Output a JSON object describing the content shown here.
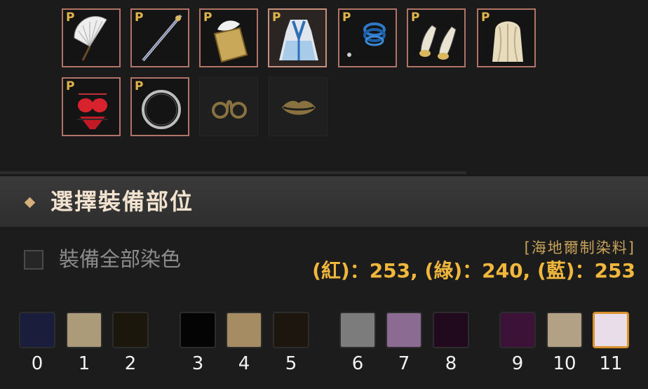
{
  "equipment": {
    "slots": [
      {
        "name": "fan",
        "premium": true,
        "badge": "P",
        "empty": false
      },
      {
        "name": "staff",
        "premium": true,
        "badge": "P",
        "empty": false
      },
      {
        "name": "book",
        "premium": true,
        "badge": "P",
        "empty": false
      },
      {
        "name": "outfit",
        "premium": true,
        "badge": "P",
        "empty": false,
        "selected": true
      },
      {
        "name": "bracelet",
        "premium": true,
        "badge": "P",
        "empty": false
      },
      {
        "name": "shoes",
        "premium": true,
        "badge": "P",
        "empty": false
      },
      {
        "name": "wig",
        "premium": true,
        "badge": "P",
        "empty": false
      },
      {
        "name": "underwear",
        "premium": true,
        "badge": "P",
        "empty": false
      },
      {
        "name": "ring",
        "premium": true,
        "badge": "P",
        "empty": false
      },
      {
        "name": "glasses",
        "premium": false,
        "empty": true
      },
      {
        "name": "lips",
        "premium": false,
        "empty": true
      }
    ]
  },
  "section": {
    "title": "選擇裝備部位"
  },
  "dye_all": {
    "label": "裝備全部染色",
    "checked": false
  },
  "dye": {
    "name": "[海地爾制染料]",
    "rgb_text": "(紅)：253, (綠)：240, (藍)：253"
  },
  "palette": [
    {
      "index": "0",
      "color": "#1b1d3c"
    },
    {
      "index": "1",
      "color": "#ab9b78"
    },
    {
      "index": "2",
      "color": "#1c170d"
    },
    {
      "index": "3",
      "color": "#040404"
    },
    {
      "index": "4",
      "color": "#a58c62"
    },
    {
      "index": "5",
      "color": "#1c160e"
    },
    {
      "index": "6",
      "color": "#7c7c7c"
    },
    {
      "index": "7",
      "color": "#8c6b92"
    },
    {
      "index": "8",
      "color": "#21091e"
    },
    {
      "index": "9",
      "color": "#3c1238"
    },
    {
      "index": "10",
      "color": "#b2a185"
    },
    {
      "index": "11",
      "color": "#e9dde9",
      "selected": true
    }
  ]
}
